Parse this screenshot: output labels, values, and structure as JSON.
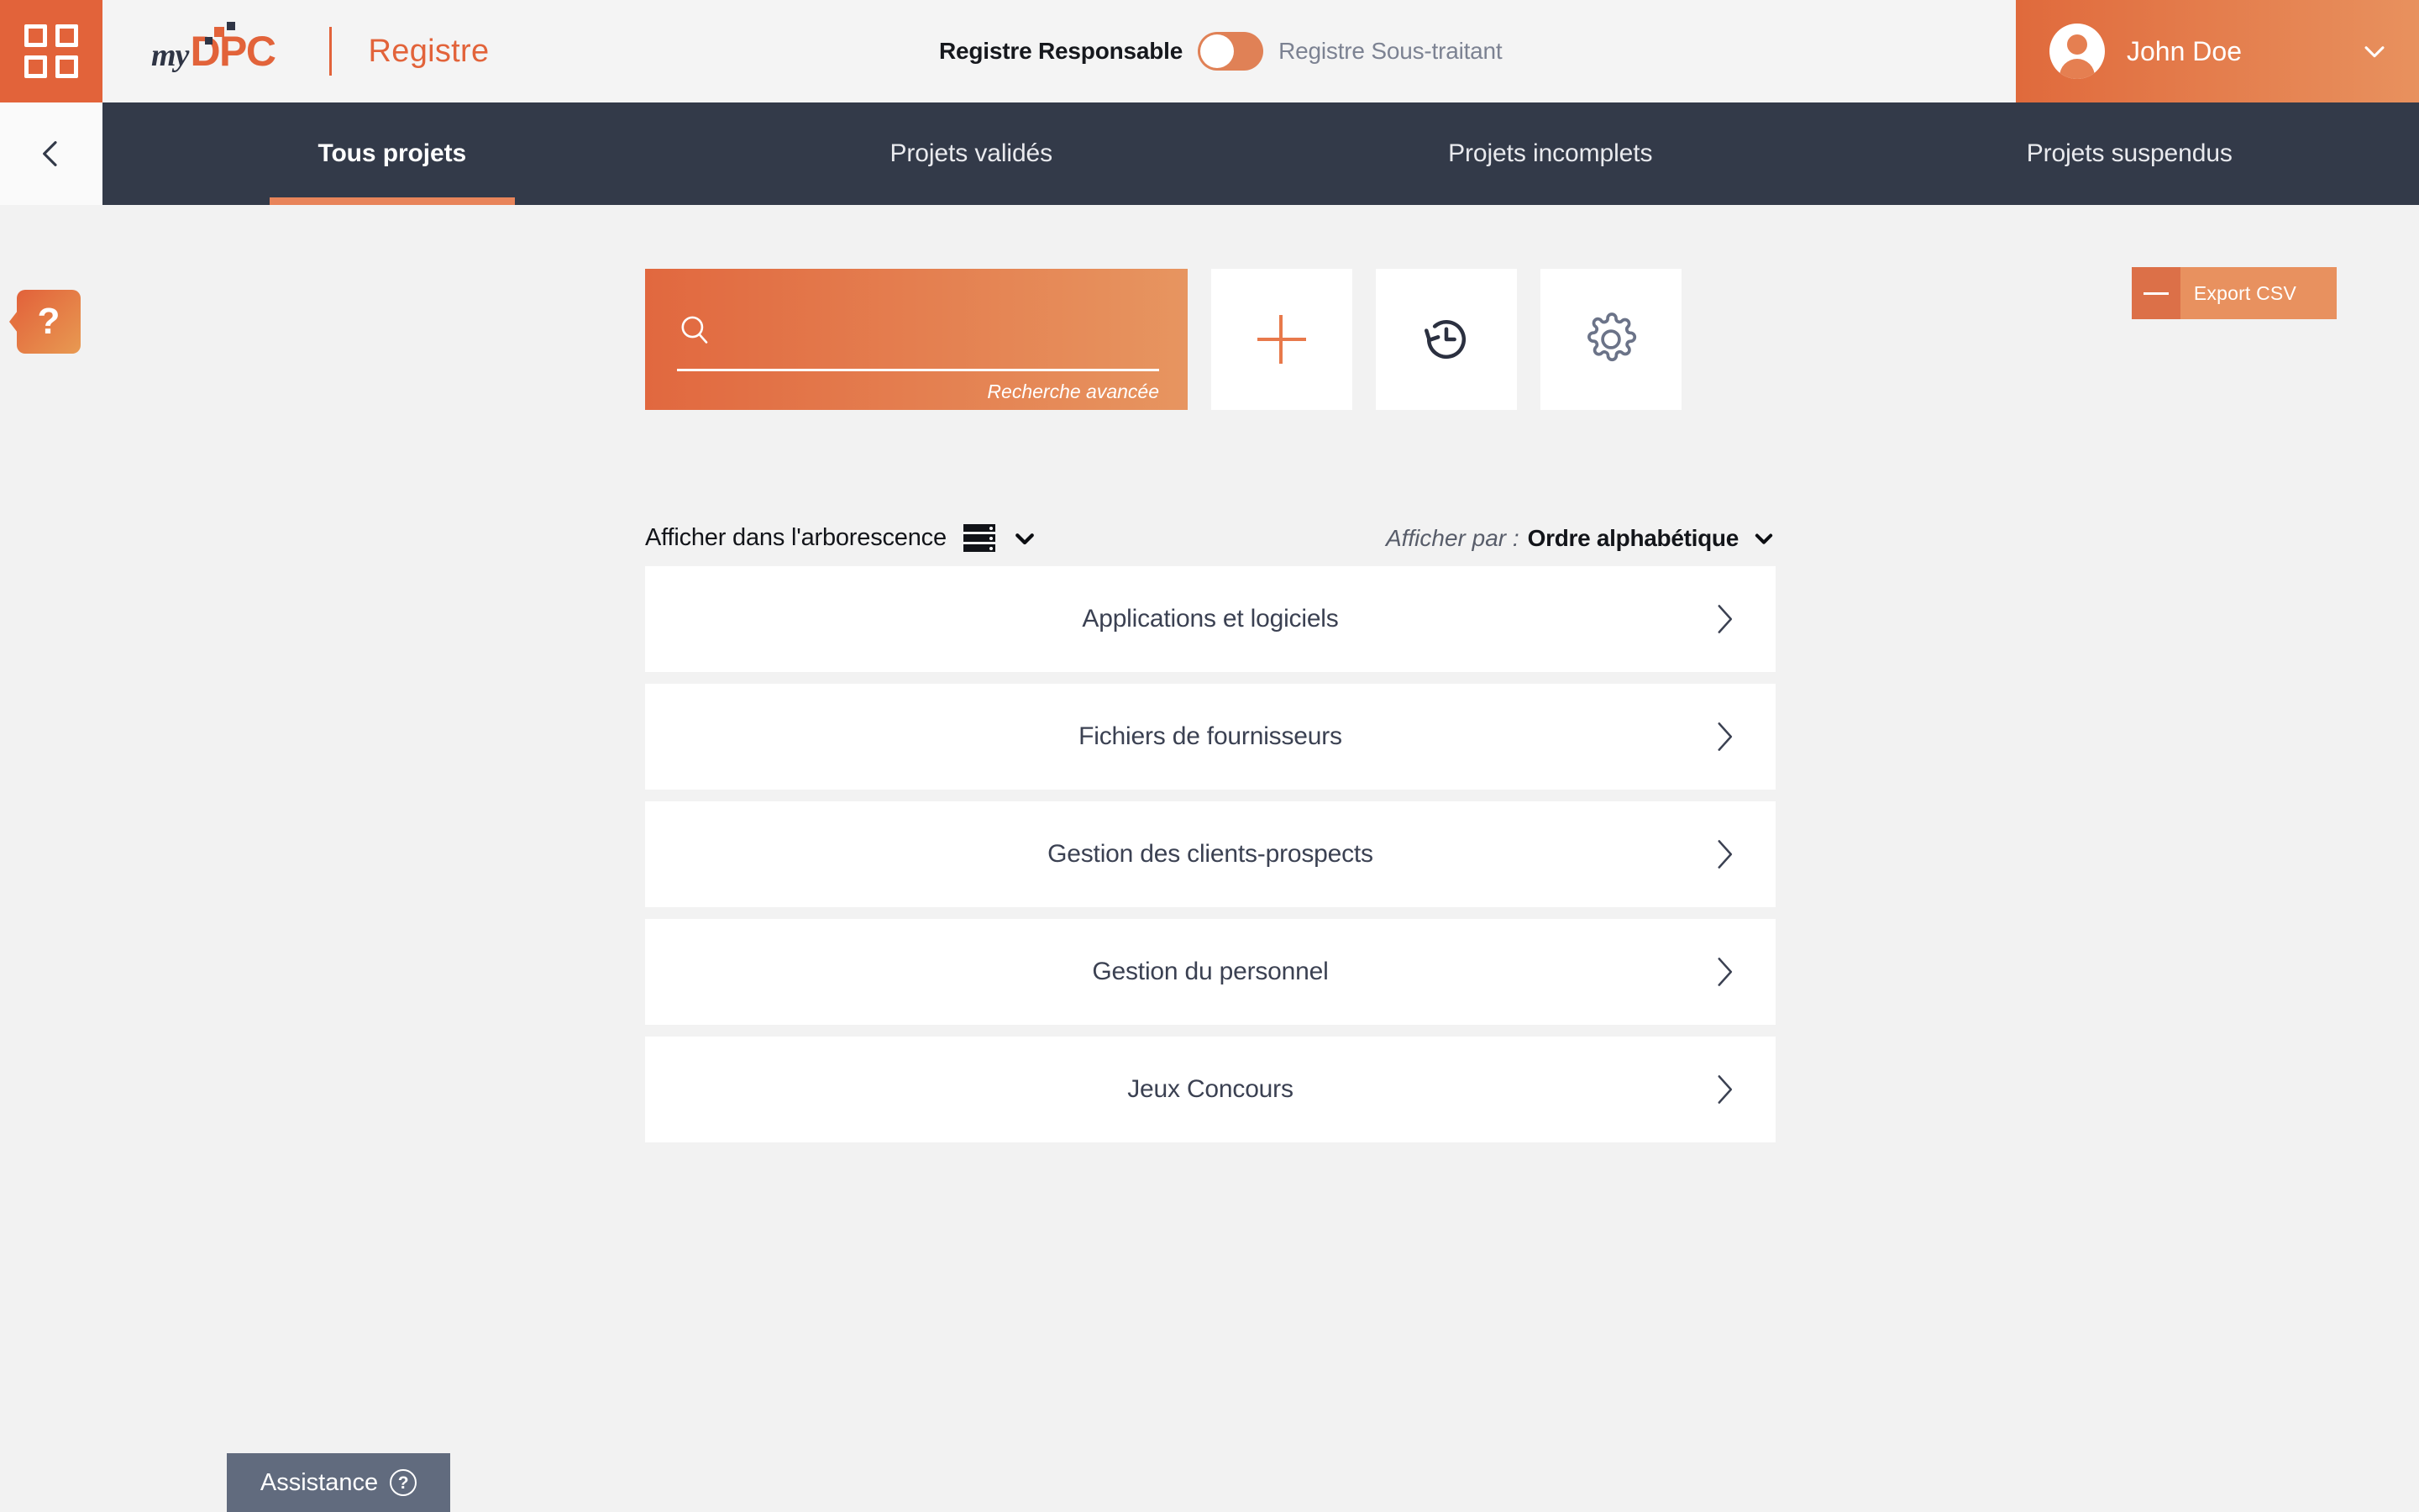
{
  "header": {
    "apps_icon": "apps-grid-icon",
    "logo_my": "my",
    "logo_dpc": "DPC",
    "page_title": "Registre",
    "switch": {
      "left_label": "Registre Responsable",
      "right_label": "Registre Sous-traitant",
      "state": "left"
    },
    "user": {
      "name": "John Doe",
      "avatar_icon": "user-avatar-icon",
      "caret_icon": "chevron-down-icon"
    }
  },
  "nav": {
    "back_icon": "chevron-left-icon",
    "tabs": [
      {
        "label": "Tous projets",
        "active": true
      },
      {
        "label": "Projets validés",
        "active": false
      },
      {
        "label": "Projets incomplets",
        "active": false
      },
      {
        "label": "Projets suspendus",
        "active": false
      }
    ]
  },
  "help_tab": {
    "label": "?"
  },
  "toolbar": {
    "search": {
      "icon": "search-icon",
      "value": "",
      "placeholder": "",
      "advanced_label": "Recherche avancée"
    },
    "buttons": [
      {
        "name": "add-button",
        "icon": "plus-icon"
      },
      {
        "name": "history-button",
        "icon": "history-clock-icon"
      },
      {
        "name": "settings-button",
        "icon": "gear-icon"
      }
    ],
    "export": {
      "label": "Export CSV",
      "icon": "dash-icon"
    }
  },
  "filters": {
    "tree_label": "Afficher dans l'arborescence",
    "tree_icon": "list-rows-icon",
    "tree_caret": "chevron-down-icon",
    "sort_prefix": "Afficher par :",
    "sort_value": "Ordre alphabétique",
    "sort_caret": "chevron-down-icon"
  },
  "list": {
    "items": [
      {
        "label": "Applications et logiciels"
      },
      {
        "label": "Fichiers de fournisseurs"
      },
      {
        "label": "Gestion des clients-prospects"
      },
      {
        "label": "Gestion du personnel"
      },
      {
        "label": "Jeux Concours"
      }
    ],
    "row_caret": "chevron-right-icon"
  },
  "assistance": {
    "label": "Assistance",
    "icon": "question-circle-icon"
  },
  "colors": {
    "accent": "#e2633a",
    "accent_light": "#e8915e",
    "nav_dark": "#333a49",
    "page_bg": "#f2f2f2",
    "text_dark": "#3b4152",
    "slate": "#616b7e"
  }
}
